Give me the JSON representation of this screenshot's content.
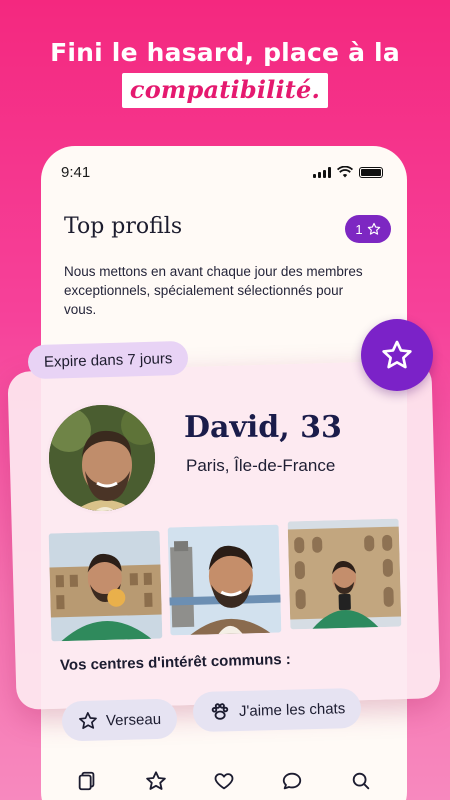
{
  "headline": {
    "line1": "Fini le hasard, place à la",
    "highlight": "compatibilité."
  },
  "status_bar": {
    "time": "9:41"
  },
  "top_profiles": {
    "title": "Top profils",
    "badge_count": "1",
    "description": "Nous mettons en avant chaque jour des membres exceptionnels, spécialement sélectionnés pour vous."
  },
  "profile": {
    "expire_label": "Expire dans 7 jours",
    "name_age": "David, 33",
    "location": "Paris, Île-de-France",
    "photos": [
      "colosseum-pizza-photo",
      "tower-bridge-selfie-photo",
      "colosseum-phone-photo"
    ]
  },
  "interests": {
    "label": "Vos centres d'intérêt communs :",
    "items": [
      {
        "label": "Verseau",
        "icon": "star-outline-icon"
      },
      {
        "label": "J'aime les chats",
        "icon": "paw-icon"
      }
    ]
  },
  "nav": {
    "items": [
      "cards-icon",
      "star-icon",
      "heart-icon",
      "chat-icon",
      "search-icon"
    ]
  },
  "colors": {
    "brand_pink": "#f4287f",
    "accent_purple": "#7b22c8",
    "navy_text": "#1a1c4a"
  }
}
